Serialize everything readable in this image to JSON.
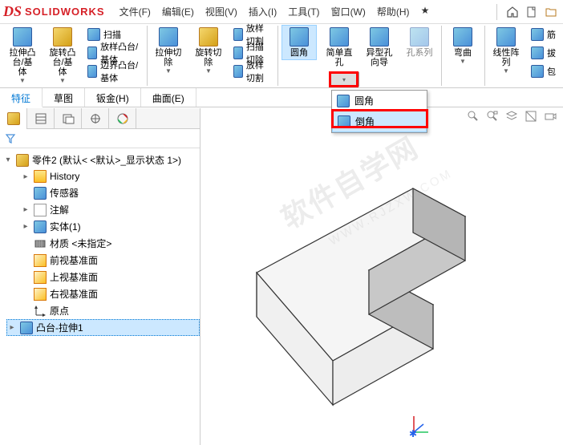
{
  "logo": {
    "ds": "DS",
    "name": "SOLIDWORKS"
  },
  "menu": {
    "file": "文件(F)",
    "edit": "编辑(E)",
    "view": "视图(V)",
    "insert": "插入(I)",
    "tools": "工具(T)",
    "window": "窗口(W)",
    "help": "帮助(H)"
  },
  "ribbon": {
    "extrudeBoss": "拉伸凸台/基体",
    "revolveBoss": "旋转凸台/基体",
    "sweep": "扫描",
    "loft": "放样凸台/基体",
    "boundary": "边界凸台/基体",
    "extrudeCut": "拉伸切除",
    "revolveCut": "旋转切除",
    "loftCut": "放样切割",
    "sweepCut": "扫描切除",
    "loftCut2": "放样切割",
    "fillet": "圆角",
    "simpleHole": "简单直孔",
    "holeWizard": "异型孔向导",
    "holeSeries": "孔系列",
    "bend": "弯曲",
    "linearPattern": "线性阵列",
    "rib": "筋",
    "draft": "拔",
    "shell": "包"
  },
  "dropdown": {
    "fillet": "圆角",
    "chamfer": "倒角"
  },
  "tabs": {
    "t1": "特征",
    "t2": "草图",
    "t3": "钣金(H)",
    "t4": "曲面(E)"
  },
  "tree": {
    "root": "零件2  (默认< <默认>_显示状态 1>)",
    "history": "History",
    "sensor": "传感器",
    "annotation": "注解",
    "solid": "实体(1)",
    "material": "材质 <未指定>",
    "front": "前视基准面",
    "top": "上视基准面",
    "right": "右视基准面",
    "origin": "原点",
    "feature1": "凸台-拉伸1"
  },
  "watermark": {
    "main": "软件自学网",
    "sub": "WWW.RJZXW.COM"
  }
}
